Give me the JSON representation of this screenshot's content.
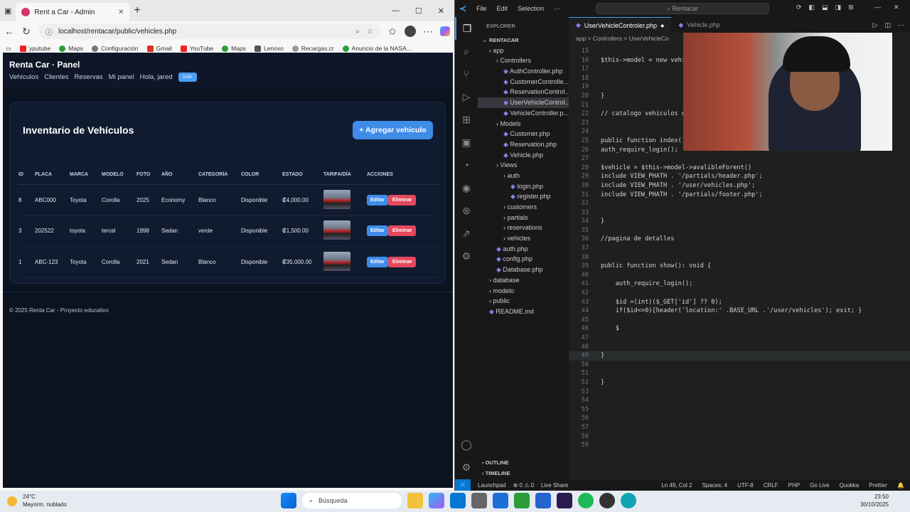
{
  "browser": {
    "tab_title": "Rent a Car - Admin",
    "url": "localhost/rentacar/public/vehicles.php",
    "bookmarks": [
      "yputube",
      "Maps",
      "Configuración",
      "Gmail",
      "YouTube",
      "Maps",
      "Lenovo",
      "Recargas.cr",
      "Anuncio de la NASA..."
    ]
  },
  "app": {
    "title": "Renta Car · Panel",
    "nav": [
      "Vehículos",
      "Clientes",
      "Reservas",
      "Mi panel",
      "Hola, jared"
    ],
    "logout": "Salir",
    "card_title": "Inventario de Vehículos",
    "add_button": "+ Agregar vehículo",
    "columns": [
      "ID",
      "PLACA",
      "MARCA",
      "MODELO",
      "FOTO",
      "AÑO",
      "CATEGORÍA",
      "COLOR",
      "ESTADO",
      "TARIFA/DÍA",
      "ACCIONES"
    ],
    "rows": [
      {
        "id": "8",
        "placa": "ABC000",
        "marca": "Toyota",
        "modelo": "Corolla",
        "foto": "2025",
        "anio": "Economy",
        "categoria": "Blanco",
        "color": "Disponible",
        "tarifa": "₡4,000.00"
      },
      {
        "id": "3",
        "placa": "202522",
        "marca": "toyota",
        "modelo": "tercel",
        "foto": "1998",
        "anio": "Sedan",
        "categoria": "verde",
        "color": "Disponible",
        "tarifa": "₡1,500.00"
      },
      {
        "id": "1",
        "placa": "ABC-123",
        "marca": "Toyota",
        "modelo": "Corolla",
        "foto": "2021",
        "anio": "Sedan",
        "categoria": "Blanco",
        "color": "Disponible",
        "tarifa": "₡35,000.00"
      }
    ],
    "edit_label": "Editar",
    "delete_label": "Eliminar",
    "footer": "© 2025 Renta Car - Proyecto educativo"
  },
  "vscode": {
    "menu": [
      "File",
      "Edit",
      "Selection",
      "···"
    ],
    "search": "Rentacar",
    "explorer_title": "EXPLORER",
    "tree": [
      {
        "label": "RENTACAR",
        "depth": 0,
        "kind": "root"
      },
      {
        "label": "app",
        "depth": 1,
        "kind": "folder"
      },
      {
        "label": "Controllers",
        "depth": 2,
        "kind": "folder"
      },
      {
        "label": "AuthController.php",
        "depth": 3,
        "kind": "file"
      },
      {
        "label": "CustomerControlle...",
        "depth": 3,
        "kind": "file"
      },
      {
        "label": "ReservationControl...",
        "depth": 3,
        "kind": "file"
      },
      {
        "label": "UserVehicleControl...",
        "depth": 3,
        "kind": "file",
        "selected": true
      },
      {
        "label": "VehicleController.p...",
        "depth": 3,
        "kind": "file"
      },
      {
        "label": "Models",
        "depth": 2,
        "kind": "folder"
      },
      {
        "label": "Customer.php",
        "depth": 3,
        "kind": "file"
      },
      {
        "label": "Reservation.php",
        "depth": 3,
        "kind": "file"
      },
      {
        "label": "Vehicle.php",
        "depth": 3,
        "kind": "file"
      },
      {
        "label": "Views",
        "depth": 2,
        "kind": "folder"
      },
      {
        "label": "auth",
        "depth": 3,
        "kind": "folder"
      },
      {
        "label": "login.php",
        "depth": 4,
        "kind": "file"
      },
      {
        "label": "register.php",
        "depth": 4,
        "kind": "file"
      },
      {
        "label": "customers",
        "depth": 3,
        "kind": "folder"
      },
      {
        "label": "partials",
        "depth": 3,
        "kind": "folder"
      },
      {
        "label": "reservations",
        "depth": 3,
        "kind": "folder"
      },
      {
        "label": "vehicles",
        "depth": 3,
        "kind": "folder"
      },
      {
        "label": "auth.php",
        "depth": 2,
        "kind": "file"
      },
      {
        "label": "config.php",
        "depth": 2,
        "kind": "file"
      },
      {
        "label": "Database.php",
        "depth": 2,
        "kind": "file"
      },
      {
        "label": "database",
        "depth": 1,
        "kind": "folder"
      },
      {
        "label": "modelo",
        "depth": 1,
        "kind": "folder"
      },
      {
        "label": "public",
        "depth": 1,
        "kind": "folder"
      },
      {
        "label": "README.md",
        "depth": 1,
        "kind": "file"
      }
    ],
    "outline": "OUTLINE",
    "timeline": "TIMELINE",
    "tabs": [
      "UserVehicleControler.php",
      "Vehicle.php"
    ],
    "breadcrumb": "app > Controllers > UserVehicleCo",
    "code_lines": [
      {
        "n": "15",
        "t": ""
      },
      {
        "n": "16",
        "t": "$this->model = new vehi"
      },
      {
        "n": "17",
        "t": ""
      },
      {
        "n": "18",
        "t": ""
      },
      {
        "n": "19",
        "t": ""
      },
      {
        "n": "20",
        "t": "}"
      },
      {
        "n": "21",
        "t": ""
      },
      {
        "n": "22",
        "t": "// catalogo vehiculos d"
      },
      {
        "n": "23",
        "t": ""
      },
      {
        "n": "24",
        "t": ""
      },
      {
        "n": "25",
        "t": "public function index()"
      },
      {
        "n": "26",
        "t": "auth_require_login();"
      },
      {
        "n": "27",
        "t": ""
      },
      {
        "n": "28",
        "t": "$vehicle = $this->model->avalibleForent()"
      },
      {
        "n": "29",
        "t": "include VIEW_PHATH . '/partials/header.php';"
      },
      {
        "n": "30",
        "t": "include VIEW_PHATH . '/user/vehicles.php';"
      },
      {
        "n": "31",
        "t": "include VIEW_PHATH . '/partials/footer.php';"
      },
      {
        "n": "32",
        "t": ""
      },
      {
        "n": "33",
        "t": ""
      },
      {
        "n": "34",
        "t": "}"
      },
      {
        "n": "35",
        "t": ""
      },
      {
        "n": "36",
        "t": "//pagina de detalles"
      },
      {
        "n": "37",
        "t": ""
      },
      {
        "n": "38",
        "t": ""
      },
      {
        "n": "39",
        "t": "public function show(): void {"
      },
      {
        "n": "40",
        "t": ""
      },
      {
        "n": "41",
        "t": "    auth_require_login();"
      },
      {
        "n": "42",
        "t": ""
      },
      {
        "n": "43",
        "t": "    $id =(int)($_GET['id'] ?? 0);"
      },
      {
        "n": "44",
        "t": "    if($id<=0){header('location:' .BASE_URL .'/user/vehicles'); exit; }"
      },
      {
        "n": "45",
        "t": ""
      },
      {
        "n": "46",
        "t": "    $"
      },
      {
        "n": "47",
        "t": ""
      },
      {
        "n": "48",
        "t": ""
      },
      {
        "n": "49",
        "t": "}"
      },
      {
        "n": "50",
        "t": ""
      },
      {
        "n": "51",
        "t": ""
      },
      {
        "n": "52",
        "t": "}"
      },
      {
        "n": "53",
        "t": ""
      },
      {
        "n": "54",
        "t": ""
      },
      {
        "n": "55",
        "t": ""
      },
      {
        "n": "56",
        "t": ""
      },
      {
        "n": "57",
        "t": ""
      },
      {
        "n": "58",
        "t": ""
      },
      {
        "n": "59",
        "t": ""
      }
    ],
    "status": {
      "launchpad": "Launchpad",
      "problems": "⊗ 0 ⚠ 0",
      "liveshare": "Live Share",
      "position": "Ln 49, Col 2",
      "spaces": "Spaces: 4",
      "encoding": "UTF-8",
      "eol": "CRLF",
      "language": "PHP",
      "golive": "Go Live",
      "quokka": "Quokka",
      "prettier": "Prettier"
    }
  },
  "taskbar": {
    "temp": "24°C",
    "weather": "Mayorm. nublado",
    "search": "Búsqueda",
    "time": "23:50",
    "date": "30/10/2025"
  }
}
